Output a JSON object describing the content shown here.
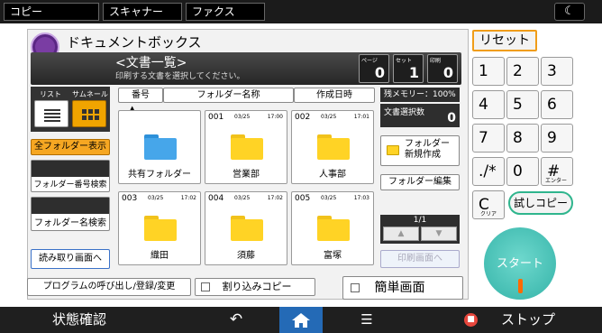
{
  "top_tabs": [
    {
      "label": "コピー"
    },
    {
      "label": "スキャナー"
    },
    {
      "label": "ファクス"
    }
  ],
  "night_icon": "moon-icon",
  "app": {
    "title": "ドキュメントボックス",
    "list_title": "<文書一覧>",
    "list_subtitle": "印刷する文書を選択してください。",
    "counters": [
      {
        "label": "ページ",
        "value": "0"
      },
      {
        "label": "セット",
        "value": "1"
      },
      {
        "label": "印刷",
        "value": "0"
      }
    ]
  },
  "view_toggle": {
    "list_label": "リスト",
    "thumb_label": "サムネール"
  },
  "left_buttons": {
    "all_folders": "全フォルダー表示",
    "folder_number_search": "フォルダー番号検索",
    "folder_name_search": "フォルダー名検索",
    "read_screen": "読み取り画面へ"
  },
  "table_headers": {
    "number": "番号",
    "folder_name": "フォルダー名称",
    "created": "作成日時"
  },
  "folders": [
    {
      "number": "",
      "date": "",
      "time": "",
      "name": "共有フォルダー",
      "color": "#46a6ea"
    },
    {
      "number": "001",
      "date": "03/25",
      "time": "17:00",
      "name": "営業部",
      "color": "#ffd325"
    },
    {
      "number": "002",
      "date": "03/25",
      "time": "17:01",
      "name": "人事部",
      "color": "#ffd325"
    },
    {
      "number": "003",
      "date": "03/25",
      "time": "17:02",
      "name": "織田",
      "color": "#ffd325"
    },
    {
      "number": "004",
      "date": "03/25",
      "time": "17:02",
      "name": "須藤",
      "color": "#ffd325"
    },
    {
      "number": "005",
      "date": "03/25",
      "time": "17:03",
      "name": "富塚",
      "color": "#ffd325"
    }
  ],
  "right_panel": {
    "memory_remaining": "残メモリー：100%",
    "selected_docs_label": "文書選択数",
    "selected_docs_value": "0",
    "new_folder": "フォルダー\n新規作成",
    "edit_folder": "フォルダー編集",
    "page": "1/1",
    "print_screen": "印刷画面へ"
  },
  "bottom_buttons": {
    "program": "プログラムの呼び出し/登録/変更",
    "interrupt": "割り込みコピー",
    "simple": "簡単画面"
  },
  "keypad": {
    "reset": "リセット",
    "keys": [
      "1",
      "2",
      "3",
      "4",
      "5",
      "6",
      "7",
      "8",
      "9",
      "./*",
      "0",
      "#"
    ],
    "enter_label": "エンター",
    "clear_key": "C",
    "clear_label": "クリア",
    "trial_copy": "試しコピー",
    "start": "スタート"
  },
  "footer": {
    "status": "状態確認",
    "back_icon": "back-arrow-icon",
    "home_icon": "home-icon",
    "menu_icon": "menu-icon",
    "stop": "ストップ"
  },
  "colors": {
    "accent": "#f6a722",
    "start": "#34b3a8",
    "home": "#246ab6",
    "stop": "#e7473d"
  }
}
